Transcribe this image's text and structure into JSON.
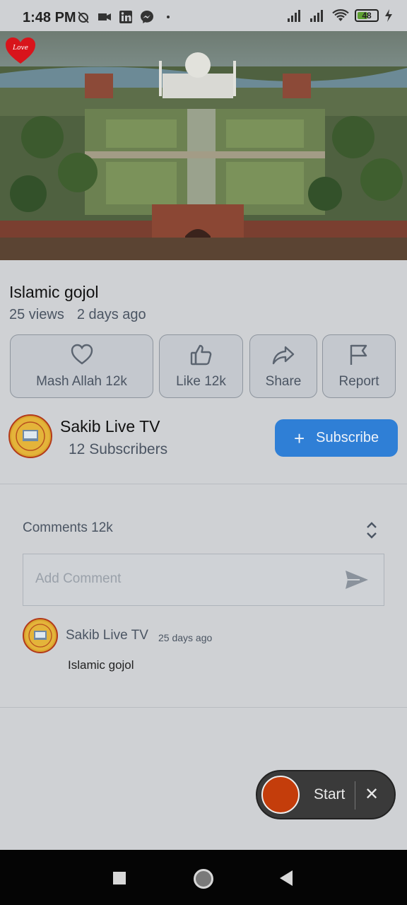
{
  "status_bar": {
    "time": "1:48 PM",
    "battery": "48",
    "icons_left": [
      "muted-alarm-icon",
      "video-camera-icon",
      "linkedin-icon",
      "messenger-icon",
      "dot-icon"
    ],
    "icons_right": [
      "signal-icon",
      "signal-icon",
      "wifi-icon",
      "battery-icon",
      "charging-icon"
    ]
  },
  "video": {
    "overlay_logo": "Love",
    "thumbnail_icon": "taj-mahal-thumbnail"
  },
  "post": {
    "title": "Islamic gojol",
    "views": "25 views",
    "age": "2 days ago"
  },
  "actions": [
    {
      "label": "Mash Allah 12k",
      "icon": "heart-icon"
    },
    {
      "label": "Like 12k",
      "icon": "thumbs-up-icon"
    },
    {
      "label": "Share",
      "icon": "share-icon"
    },
    {
      "label": "Report",
      "icon": "flag-icon"
    }
  ],
  "channel": {
    "name": "Sakib Live TV",
    "subscribers": "12 Subscribers",
    "subscribe_label": "Subscribe",
    "subscribe_icon": "plus-icon"
  },
  "comments": {
    "header_label": "Comments 12k",
    "input_placeholder": "Add Comment",
    "items": [
      {
        "author": "Sakib Live TV",
        "time": "25 days ago",
        "text": "Islamic gojol"
      }
    ]
  },
  "floating_recorder": {
    "start_label": "Start",
    "close_label": "✕"
  },
  "colors": {
    "accent_blue": "#2f7fd6",
    "record_red": "#c43d0b",
    "background": "#cfd1d4"
  }
}
